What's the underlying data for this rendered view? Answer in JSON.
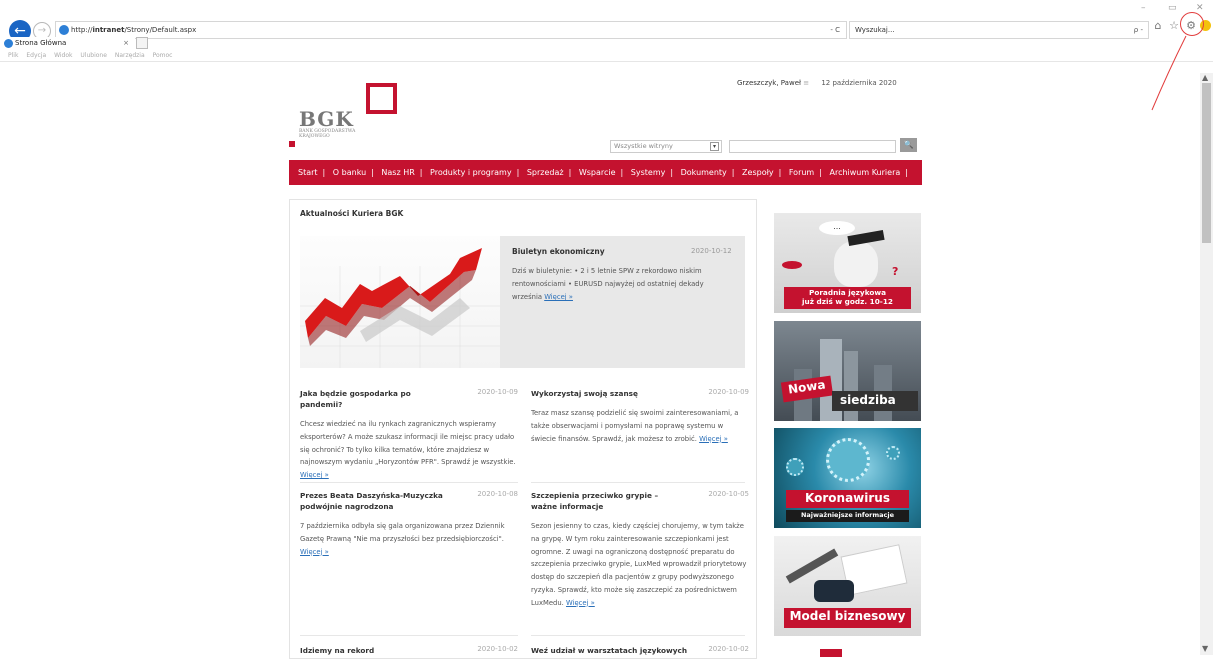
{
  "browser": {
    "url_prefix": "http://",
    "url_host": "intranet",
    "url_path": "/Strony/Default.aspx",
    "address_tail": "- C",
    "search_placeholder": "Wyszukaj...",
    "search_tail": "ρ -",
    "tab_title": "Strona Główna",
    "tab_close": "×",
    "menu": [
      "Plik",
      "Edycja",
      "Widok",
      "Ulubione",
      "Narzędzia",
      "Pomoc"
    ]
  },
  "header": {
    "user": "Grzeszczyk, Paweł",
    "user_menu": "≡",
    "date": "12 października 2020",
    "logo": "BGK",
    "logo_sub": "BANK GOSPODARSTWA KRAJOWEGO",
    "site_scope": "Wszystkie witryny",
    "search_button": "🔍"
  },
  "nav": [
    "Start",
    "O banku",
    "Nasz HR",
    "Produkty i programy",
    "Sprzedaż",
    "Wsparcie",
    "Systemy",
    "Dokumenty",
    "Zespoły",
    "Forum",
    "Archiwum Kuriera"
  ],
  "news": {
    "title": "Aktualności Kuriera BGK",
    "featured": {
      "title": "Biuletyn ekonomiczny",
      "date": "2020-10-12",
      "text": "Dziś w biuletynie: • 2 i 5 letnie SPW z rekordowo niskim rentownościami • EURUSD najwyżej od ostatniej dekady września",
      "more": "Więcej »"
    },
    "articles": [
      {
        "title": "Jaka będzie gospodarka po pandemii?",
        "date": "2020-10-09",
        "body": "Chcesz wiedzieć na ilu rynkach zagranicznych wspieramy eksporterów? A może szukasz informacji ile miejsc pracy udało się ochronić? To tylko kilka tematów, które znajdziesz w najnowszym wydaniu „Horyzontów PFR\". Sprawdź je wszystkie.",
        "more": "Więcej »"
      },
      {
        "title": "Wykorzystaj swoją szansę",
        "date": "2020-10-09",
        "body": "Teraz masz szansę podzielić się swoimi zainteresowaniami, a także obserwacjami i pomysłami na poprawę systemu w świecie finansów. Sprawdź, jak możesz to zrobić.",
        "more": "Więcej »"
      },
      {
        "title": "Prezes Beata Daszyńska-Muzyczka podwójnie nagrodzona",
        "date": "2020-10-08",
        "body": "7 października odbyła się gala organizowana przez Dziennik Gazetę Prawną \"Nie ma przyszłości bez przedsiębiorczości\".",
        "more": "Więcej »"
      },
      {
        "title": "Szczepienia przeciwko grypie – ważne informacje",
        "date": "2020-10-05",
        "body": "Sezon jesienny to czas, kiedy częściej chorujemy, w tym także na grypę. W tym roku zainteresowanie szczepionkami jest ogromne. Z uwagi na ograniczoną dostępność preparatu do szczepienia przeciwko grypie, LuxMed wprowadził priorytetowy dostęp do szczepień dla pacjentów z grupy podwyższonego ryzyka. Sprawdź, kto może się zaszczepić za pośrednictwem LuxMedu.",
        "more": "Więcej »"
      },
      {
        "title": "Idziemy na rekord",
        "date": "2020-10-02",
        "body": "",
        "more": ""
      },
      {
        "title": "Weź udział w warsztatach językowych",
        "date": "2020-10-02",
        "body": "",
        "more": ""
      }
    ]
  },
  "banners": [
    {
      "line1": "Poradnia językowa",
      "line2": "już dziś w godz. 10-12",
      "bubble": "..."
    },
    {
      "line1": "Nowa",
      "line2": "siedziba"
    },
    {
      "line1": "Koronawirus",
      "line2": "Najważniejsze informacje"
    },
    {
      "line1": "Model biznesowy"
    }
  ],
  "colors": {
    "brand": "#c4122f",
    "link": "#2a6fb8"
  }
}
